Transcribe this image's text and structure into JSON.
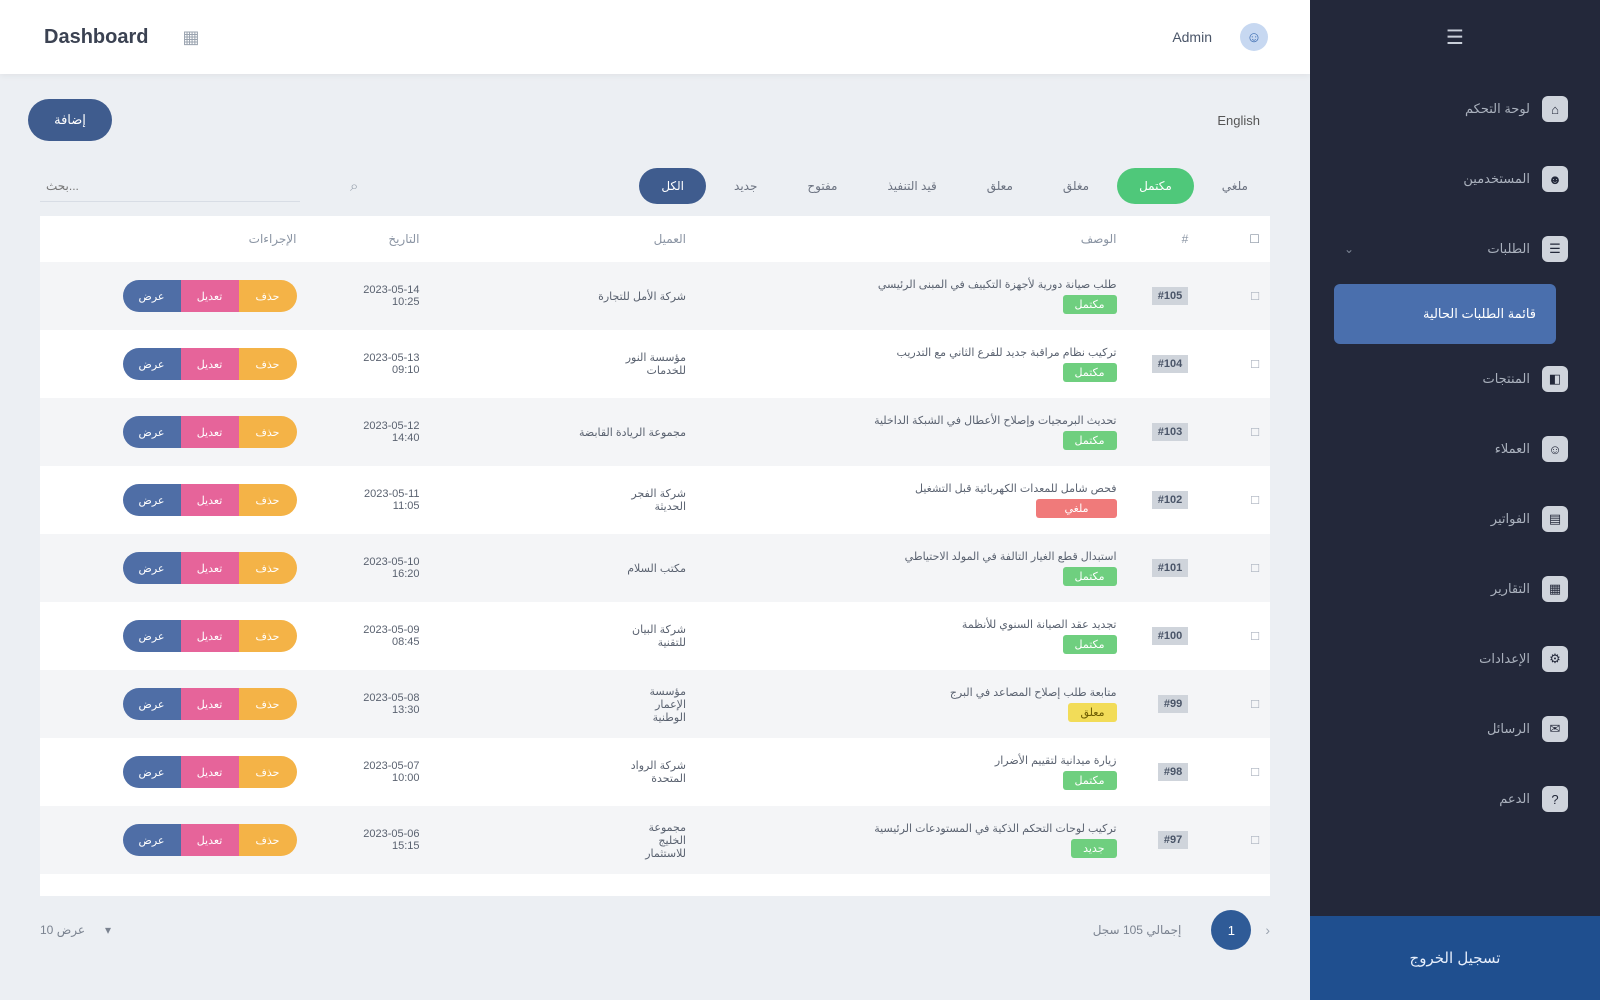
{
  "topbar": {
    "brand": "Dashboard",
    "brand_icon": "grid-icon",
    "user_name": "Admin",
    "user_avatar": "☺"
  },
  "toolbar": {
    "add_label": "إضافة",
    "lang_label": "English"
  },
  "filters": {
    "search_placeholder": "بحث...",
    "tabs": [
      {
        "label": "الكل",
        "active": true
      },
      {
        "label": "جديد"
      },
      {
        "label": "مفتوح"
      },
      {
        "label": "قيد التنفيذ"
      },
      {
        "label": "معلق"
      },
      {
        "label": "مغلق"
      },
      {
        "label": "مكتمل",
        "green": true
      },
      {
        "label": "ملغي"
      }
    ]
  },
  "table": {
    "columns": [
      "الإجراءات",
      "التاريخ",
      "العميل",
      "الوصف",
      "#",
      "☐"
    ],
    "action_labels": {
      "view": "عرض",
      "edit": "تعديل",
      "delete": "حذف"
    },
    "rows": [
      {
        "date": "2023-05-14\n10:25",
        "client": "شركة الأمل للتجارة",
        "desc": "طلب صيانة دورية لأجهزة التكييف في المبنى الرئيسي",
        "status": "مكتمل",
        "status_color": "green",
        "id": "#105"
      },
      {
        "date": "2023-05-13\n09:10",
        "client": "مؤسسة النور\nللخدمات",
        "desc": "تركيب نظام مراقبة جديد للفرع الثاني مع التدريب",
        "status": "مكتمل",
        "status_color": "green",
        "id": "#104"
      },
      {
        "date": "2023-05-12\n14:40",
        "client": "مجموعة الريادة القابضة",
        "desc": "تحديث البرمجيات وإصلاح الأعطال في الشبكة الداخلية",
        "status": "مكتمل",
        "status_color": "green",
        "id": "#103"
      },
      {
        "date": "2023-05-11\n11:05",
        "client": "شركة الفجر\nالحديثة",
        "desc": "فحص شامل للمعدات الكهربائية قبل التشغيل",
        "status": "ملغي",
        "status_color": "red",
        "id": "#102"
      },
      {
        "date": "2023-05-10\n16:20",
        "client": "مكتب السلام",
        "desc": "استبدال قطع الغيار التالفة في المولد الاحتياطي",
        "status": "مكتمل",
        "status_color": "green",
        "id": "#101"
      },
      {
        "date": "2023-05-09\n08:45",
        "client": "شركة البيان\nللتقنية",
        "desc": "تجديد عقد الصيانة السنوي للأنظمة",
        "status": "مكتمل",
        "status_color": "green",
        "id": "#100"
      },
      {
        "date": "2023-05-08\n13:30",
        "client": "مؤسسة\nالإعمار\nالوطنية",
        "desc": "متابعة طلب إصلاح المصاعد في البرج",
        "status": "معلق",
        "status_color": "yellow",
        "id": "#99"
      },
      {
        "date": "2023-05-07\n10:00",
        "client": "شركة الرواد\nالمتحدة",
        "desc": "زيارة ميدانية لتقييم الأضرار",
        "status": "مكتمل",
        "status_color": "green",
        "id": "#98"
      },
      {
        "date": "2023-05-06\n15:15",
        "client": "مجموعة\nالخليج\nللاستثمار",
        "desc": "تركيب لوحات التحكم الذكية في المستودعات الرئيسية",
        "status": "جديد",
        "status_color": "green",
        "id": "#97"
      }
    ]
  },
  "footer": {
    "page_info": "عرض 10",
    "page_size": "▾",
    "total_text": "إجمالي 105 سجل",
    "current_page": "1",
    "next_icon": "›"
  },
  "sidebar": {
    "header_icon": "☰",
    "items": [
      {
        "label": "لوحة التحكم",
        "icon": "⌂"
      },
      {
        "label": "المستخدمين",
        "icon": "☻"
      },
      {
        "label": "الطلبات",
        "icon": "☰",
        "expanded": true
      },
      {
        "label": "المنتجات",
        "icon": "◧"
      },
      {
        "label": "العملاء",
        "icon": "☺"
      },
      {
        "label": "الفواتير",
        "icon": "▤"
      },
      {
        "label": "التقارير",
        "icon": "▦"
      },
      {
        "label": "الإعدادات",
        "icon": "⚙"
      },
      {
        "label": "الرسائل",
        "icon": "✉"
      },
      {
        "label": "الدعم",
        "icon": "?"
      }
    ],
    "active_sub": "قائمة الطلبات الحالية",
    "footer_label": "تسجيل الخروج"
  },
  "colors": {
    "primary": "#3f5c8e",
    "sidebar_bg": "#23283a",
    "sidebar_footer": "#1f4f8f",
    "success": "#4fc87a",
    "danger": "#f07a7a",
    "warning": "#f2dc58",
    "action_view": "#4f6ea6",
    "action_edit": "#e6649a",
    "action_delete": "#f4b347"
  }
}
